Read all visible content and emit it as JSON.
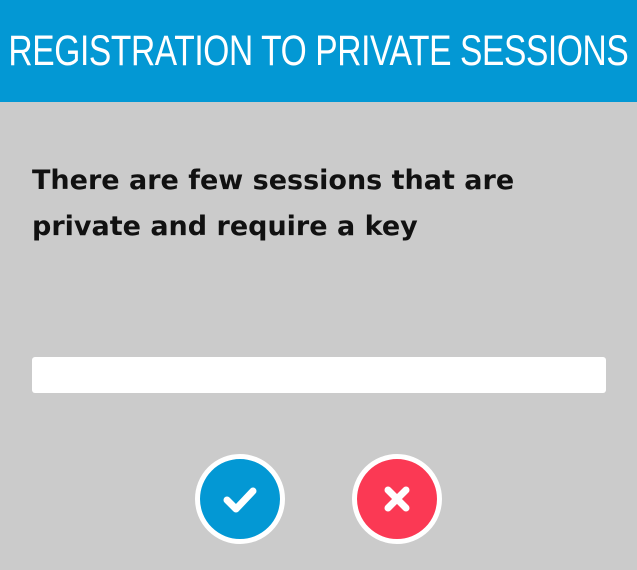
{
  "dialog": {
    "title": "REGISTRATION TO PRIVATE SESSIONS",
    "message": "There are few sessions that are private and require a key",
    "key_input": {
      "value": "",
      "placeholder": ""
    },
    "confirm_icon": "check-icon",
    "cancel_icon": "close-icon"
  },
  "colors": {
    "header": "#0398d4",
    "background": "#cbcbcb",
    "confirm": "#0398d4",
    "cancel": "#fb3954"
  }
}
